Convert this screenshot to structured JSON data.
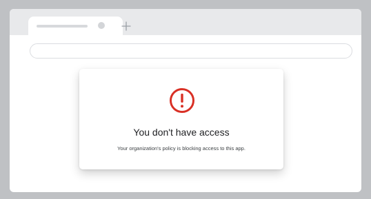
{
  "icons": {
    "alert": "exclamation-circle-icon",
    "new_tab": "plus-icon",
    "tab_close": "close-icon"
  },
  "colors": {
    "alert": "#d93025",
    "page_background": "#bfc1c4",
    "tab_strip": "#e8e9eb"
  },
  "dialog": {
    "title": "You don't have access",
    "message": "Your organization's policy is blocking access to this app."
  }
}
